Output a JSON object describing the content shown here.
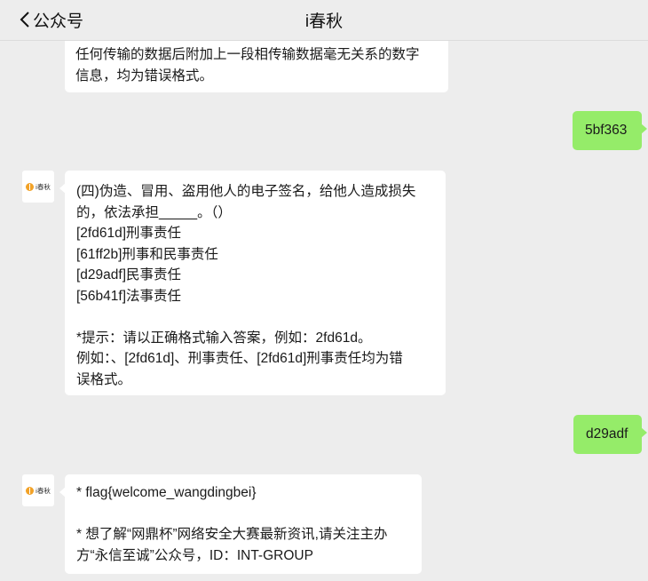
{
  "header": {
    "back_label": "公众号",
    "title": "i春秋"
  },
  "messages": {
    "first_bot": {
      "lines": [
        "任何传输的数据后附加上一段相传输数据毫无关系的数字",
        "信息，均为错误格式。"
      ]
    },
    "reply1": "5bf363",
    "question": {
      "lines": [
        "(四)伪造、冒用、盗用他人的电子签名，给他人造成损失",
        "的，依法承担_____。（）",
        "[2fd61d]刑事责任",
        "[61ff2b]刑事和民事责任",
        "[d29adf]民事责任",
        "[56b41f]法事责任",
        "",
        "*提示：请以正确格式输入答案，例如：2fd61d。",
        "例如：、[2fd61d]、刑事责任、[2fd61d]刑事责任均为错",
        "误格式。"
      ]
    },
    "reply2": "d29adf",
    "flag": {
      "lines": [
        "* flag{welcome_wangdingbei}",
        "",
        "* 想了解“网鼎杯”网络安全大赛最新资讯,请关注主办",
        "方“永信至诚”公众号，ID：INT-GROUP"
      ]
    }
  },
  "avatar": {
    "name": "i春秋"
  }
}
